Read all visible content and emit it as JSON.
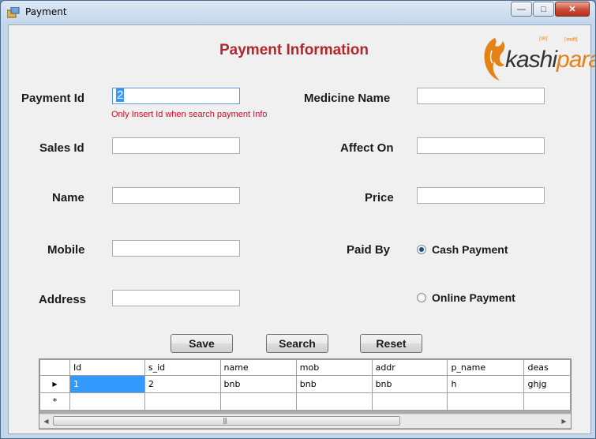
{
  "window": {
    "title": "Payment",
    "icon": "app-window-icon",
    "controls": {
      "minimize": "—",
      "maximize": "□",
      "close": "✕"
    }
  },
  "heading": "Payment Information",
  "logo": {
    "brand_a": "kashi",
    "brand_b": "para",
    "small_a": "[IR]",
    "small_b": "[काशी]"
  },
  "form": {
    "payment_id": {
      "label": "Payment Id",
      "value": "2",
      "hint": "Only Insert Id when search payment Info"
    },
    "sales_id": {
      "label": "Sales Id",
      "value": ""
    },
    "name": {
      "label": "Name",
      "value": ""
    },
    "mobile": {
      "label": "Mobile",
      "value": ""
    },
    "address": {
      "label": "Address",
      "value": ""
    },
    "medicine_name": {
      "label": "Medicine Name",
      "value": ""
    },
    "affect_on": {
      "label": "Affect On",
      "value": ""
    },
    "price": {
      "label": "Price",
      "value": ""
    },
    "paid_by": {
      "label": "Paid By",
      "options": [
        {
          "label": "Cash Payment",
          "selected": true
        },
        {
          "label": "Online Payment",
          "selected": false
        }
      ]
    }
  },
  "buttons": {
    "save": "Save",
    "search": "Search",
    "reset": "Reset"
  },
  "grid": {
    "columns": [
      "Id",
      "s_id",
      "name",
      "mob",
      "addr",
      "p_name",
      "deas"
    ],
    "rows": [
      [
        "1",
        "2",
        "bnb",
        "bnb",
        "bnb",
        "h",
        "ghjg"
      ]
    ],
    "current_row_marker": "▶",
    "new_row_marker": "*",
    "scroll_grip": "|||",
    "scroll_left": "◀",
    "scroll_right": "▶"
  }
}
